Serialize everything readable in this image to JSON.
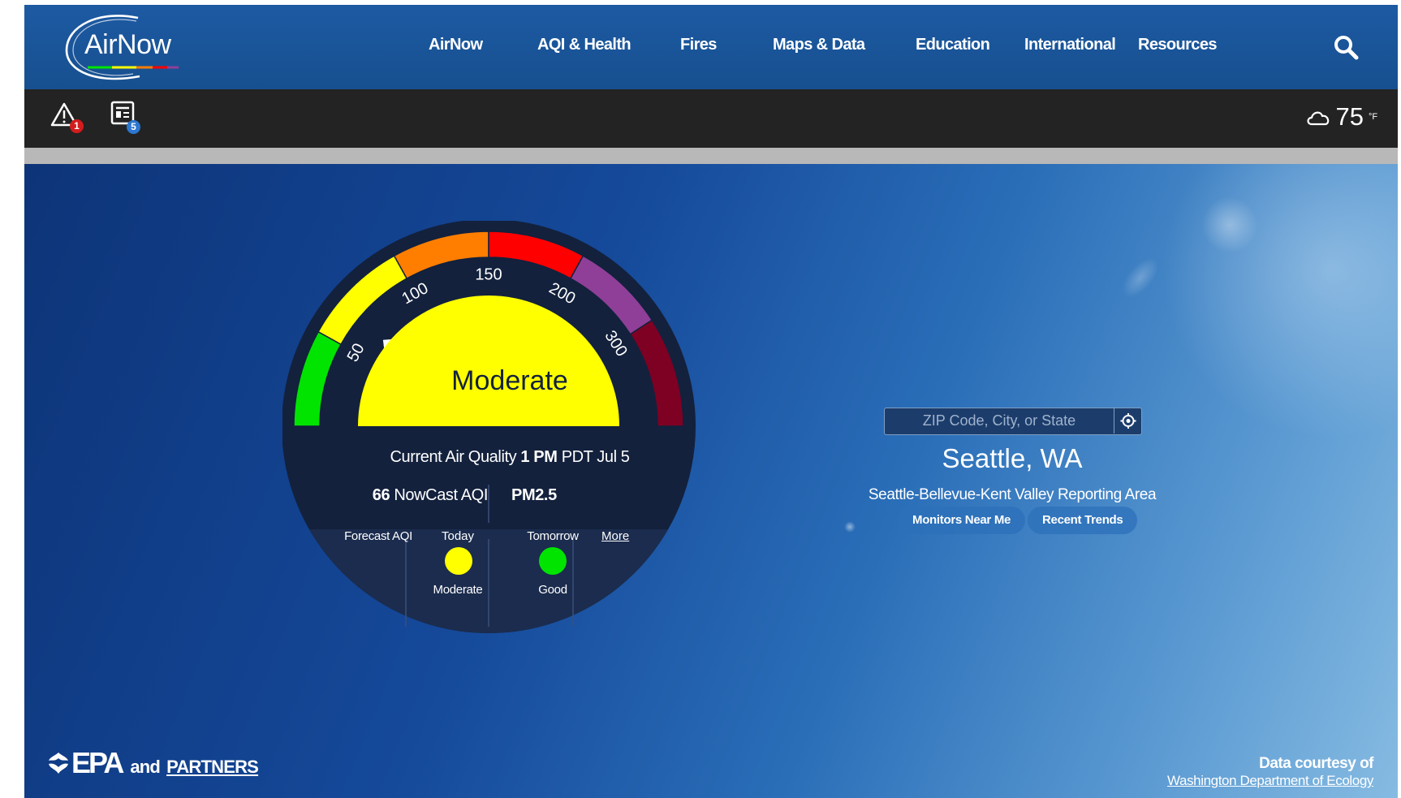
{
  "header": {
    "logo_text": "AirNow",
    "nav": [
      "AirNow",
      "AQI & Health",
      "Fires",
      "Maps & Data",
      "Education",
      "International",
      "Resources"
    ],
    "search_icon": "search-icon"
  },
  "alert_bar": {
    "alerts_icon": "warning-icon",
    "alerts_count": "1",
    "news_icon": "news-icon",
    "news_count": "5",
    "weather_icon": "cloud-icon",
    "temperature": "75",
    "temperature_unit": "°F"
  },
  "gauge": {
    "category": "Moderate",
    "current_aqi_value": 66,
    "scale_labels": [
      "50",
      "100",
      "150",
      "200",
      "300"
    ],
    "colors": {
      "good": "#00e400",
      "moderate": "#ffff00",
      "usg": "#ff7e00",
      "unhealthy": "#ff0000",
      "very_unhealthy": "#8f3f97",
      "hazardous": "#7e0023",
      "dial": "#13213d"
    },
    "current_label": "Current Air Quality",
    "current_time": "1 PM",
    "current_tz_date": "PDT Jul 5",
    "aqi_value": "66",
    "aqi_label": "NowCast AQI",
    "pollutant": "PM2.5",
    "forecast_label": "Forecast AQI",
    "forecast": [
      {
        "day": "Today",
        "category": "Moderate",
        "color": "#ffff00"
      },
      {
        "day": "Tomorrow",
        "category": "Good",
        "color": "#00e400"
      }
    ],
    "more_link": "More"
  },
  "location": {
    "search_placeholder": "ZIP Code, City, or State",
    "locate_icon": "locate-icon",
    "city": "Seattle, WA",
    "reporting_area": "Seattle-Bellevue-Kent Valley Reporting Area",
    "buttons": [
      "Monitors Near Me",
      "Recent Trends"
    ]
  },
  "footer": {
    "epa_logo": "epa-logo",
    "epa_name": "EPA",
    "and_text": "and",
    "partners_link": "PARTNERS",
    "courtesy_label": "Data courtesy of",
    "courtesy_link": "Washington Department of Ecology"
  }
}
